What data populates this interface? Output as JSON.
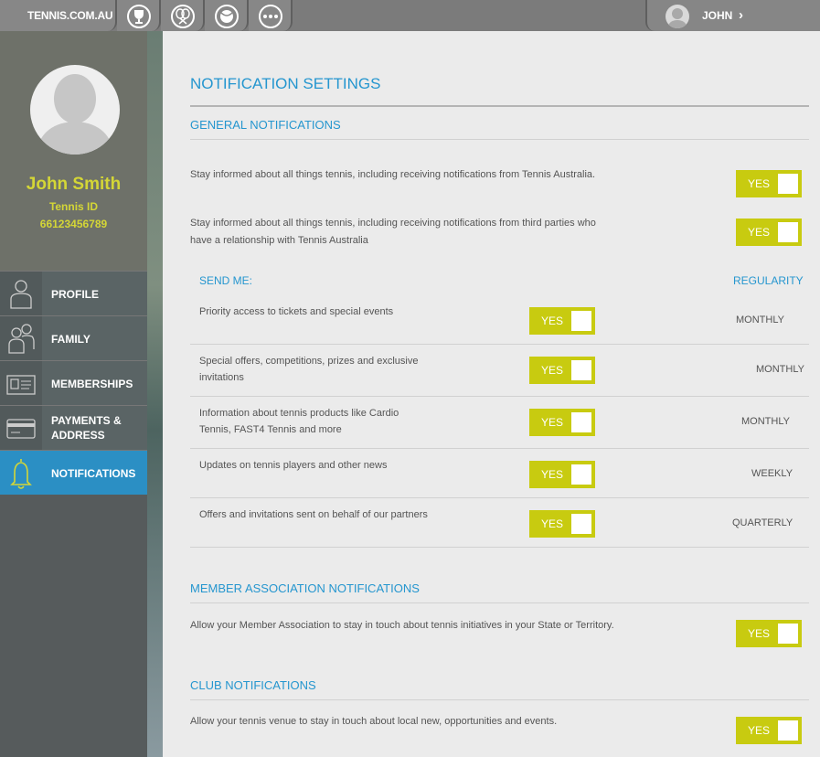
{
  "topbar": {
    "brand": "TENNIS.COM.AU",
    "icons": [
      "trophy-icon",
      "rackets-icon",
      "ball-icon",
      "more-icon"
    ],
    "user": "JOHN",
    "chevron": "›"
  },
  "sidebar": {
    "name": "John Smith",
    "tennis_id_label": "Tennis ID",
    "tennis_id": "66123456789",
    "items": [
      {
        "label": "PROFILE",
        "icon": "person-icon"
      },
      {
        "label": "FAMILY",
        "icon": "family-icon"
      },
      {
        "label": "MEMBERSHIPS",
        "icon": "id-card-icon"
      },
      {
        "label": "PAYMENTS &",
        "label2": "ADDRESS",
        "icon": "credit-card-icon"
      },
      {
        "label": "NOTIFICATIONS",
        "icon": "bell-icon",
        "active": true
      }
    ]
  },
  "main": {
    "title": "NOTIFICATION SETTINGS",
    "general": {
      "heading": "GENERAL NOTIFICATIONS",
      "row1": "Stay informed about all things tennis, including receiving notifications from Tennis Australia.",
      "row2a": "Stay informed about all things tennis, including receiving notifications from third parties who",
      "row2b": "have a relationship with Tennis Australia",
      "toggle": "YES"
    },
    "send_me": {
      "label": "SEND ME:",
      "regularity_label": "REGULARITY",
      "items": [
        {
          "text": "Priority access to tickets and special events",
          "text2": "",
          "toggle": "YES",
          "regularity": "MONTHLY"
        },
        {
          "text": "Special offers, competitions, prizes and exclusive",
          "text2": "invitations",
          "toggle": "YES",
          "regularity": "MONTHLY"
        },
        {
          "text": "Information about tennis products like Cardio",
          "text2": "Tennis, FAST4 Tennis and more",
          "toggle": "YES",
          "regularity": "MONTHLY"
        },
        {
          "text": "Updates on tennis players and other news",
          "text2": "",
          "toggle": "YES",
          "regularity": "WEEKLY"
        },
        {
          "text": "Offers and invitations sent on behalf of our partners",
          "text2": "",
          "toggle": "YES",
          "regularity": "QUARTERLY"
        }
      ]
    },
    "member": {
      "heading": "MEMBER ASSOCIATION NOTIFICATIONS",
      "row": "Allow your Member Association to stay in touch about tennis initiatives in your State or Territory.",
      "toggle": "YES"
    },
    "club": {
      "heading": "CLUB NOTIFICATIONS",
      "row": "Allow your tennis venue to stay in touch about local new, opportunities and events.",
      "toggle": "YES"
    }
  }
}
